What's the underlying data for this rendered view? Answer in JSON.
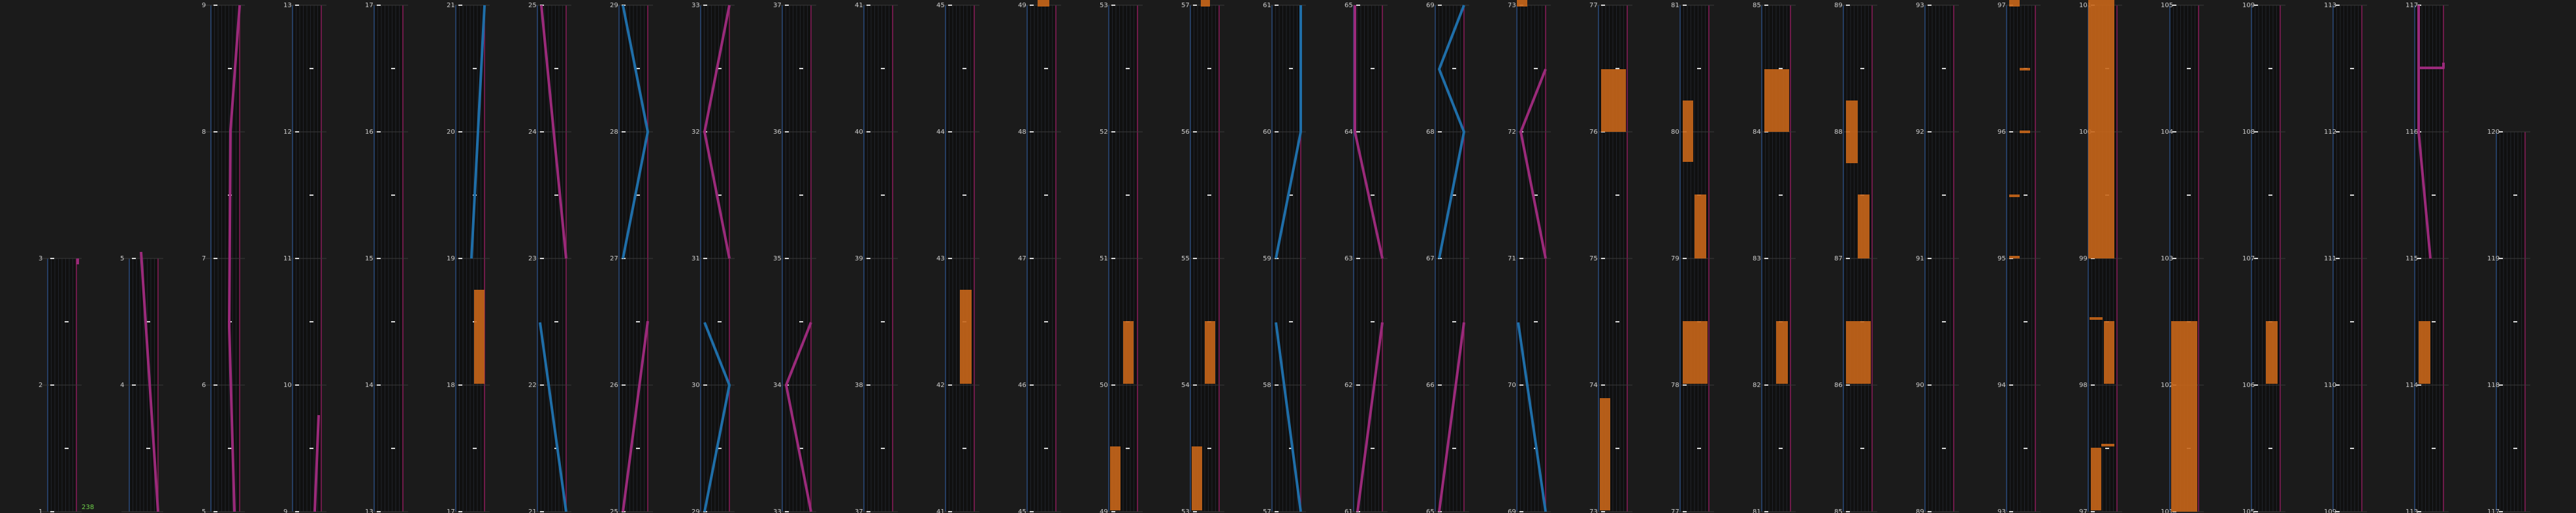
{
  "colors": {
    "background": "#1b1b1b",
    "panel": "#101010",
    "grid": "#2e3440",
    "rule": "#3a3a3a",
    "edge_left": "#2a4a7a",
    "edge_right": "#8a1c5a",
    "blue": "#1f6ea8",
    "magenta": "#9a2a7a",
    "orange": "#c8661a",
    "tick": "#d8d8d8",
    "label": "#c8c8c8",
    "label_green": "#6fd04a"
  },
  "panels": [
    {
      "labels": [
        "3",
        "2",
        "1"
      ],
      "extra_label": "238"
    },
    {
      "labels": [
        "5",
        "4"
      ]
    },
    {
      "labels": [
        "9",
        "8",
        "7",
        "6",
        "5"
      ]
    },
    {
      "labels": [
        "13",
        "12",
        "11",
        "10",
        "9"
      ]
    },
    {
      "labels": [
        "17",
        "16",
        "15",
        "14",
        "13"
      ]
    },
    {
      "labels": [
        "21",
        "20",
        "19",
        "18",
        "17"
      ]
    },
    {
      "labels": [
        "25",
        "24",
        "23",
        "22",
        "21"
      ]
    },
    {
      "labels": [
        "29",
        "28",
        "27",
        "26",
        "25"
      ]
    },
    {
      "labels": [
        "33",
        "32",
        "31",
        "30",
        "29"
      ]
    },
    {
      "labels": [
        "37",
        "36",
        "35",
        "34",
        "33"
      ]
    },
    {
      "labels": [
        "41",
        "40",
        "39",
        "38",
        "37"
      ]
    },
    {
      "labels": [
        "45",
        "44",
        "43",
        "42",
        "41"
      ]
    },
    {
      "labels": [
        "49",
        "48",
        "47",
        "46",
        "45"
      ]
    },
    {
      "labels": [
        "53",
        "52",
        "51",
        "50",
        "49"
      ]
    },
    {
      "labels": [
        "57",
        "56",
        "55",
        "54",
        "53"
      ]
    },
    {
      "labels": [
        "61",
        "60",
        "59",
        "58",
        "57"
      ]
    },
    {
      "labels": [
        "65",
        "64",
        "63",
        "62",
        "61"
      ]
    },
    {
      "labels": [
        "69",
        "68",
        "67",
        "66",
        "65"
      ]
    },
    {
      "labels": [
        "73",
        "72",
        "71",
        "70",
        "69"
      ]
    },
    {
      "labels": [
        "77",
        "76",
        "75",
        "74",
        "73"
      ]
    },
    {
      "labels": [
        "81",
        "80",
        "79",
        "78",
        "77"
      ]
    },
    {
      "labels": [
        "85",
        "84",
        "83",
        "82",
        "81"
      ]
    },
    {
      "labels": [
        "89",
        "88",
        "87",
        "86",
        "85"
      ]
    },
    {
      "labels": [
        "93",
        "92",
        "91",
        "90",
        "89"
      ]
    },
    {
      "labels": [
        "97",
        "96",
        "95",
        "94",
        "93"
      ]
    },
    {
      "labels": [
        "101",
        "100",
        "99",
        "98",
        "97"
      ]
    },
    {
      "labels": [
        "105",
        "104",
        "103",
        "102",
        "101"
      ]
    },
    {
      "labels": [
        "109",
        "108",
        "107",
        "106",
        "105"
      ]
    },
    {
      "labels": [
        "113",
        "112",
        "111",
        "110",
        "109"
      ]
    },
    {
      "labels": [
        "117",
        "116",
        "115",
        "114",
        "113"
      ]
    },
    {
      "labels": [
        "120",
        "119",
        "118",
        "117"
      ]
    }
  ]
}
